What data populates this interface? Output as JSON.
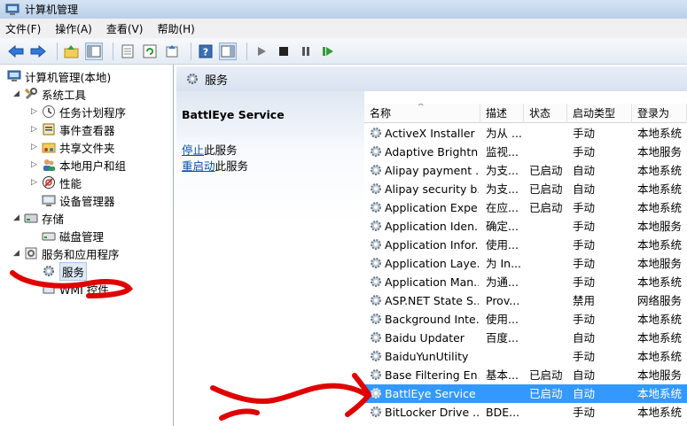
{
  "window": {
    "title": "计算机管理"
  },
  "menu": [
    "文件(F)",
    "操作(A)",
    "查看(V)",
    "帮助(H)"
  ],
  "toolbar": {
    "icons": [
      "back-icon",
      "forward-icon",
      "up-icon",
      "show-hide-tree-icon",
      "properties-icon",
      "refresh-icon",
      "export-icon",
      "help-icon",
      "show-hide-action-icon",
      "start-icon",
      "stop-icon",
      "pause-icon",
      "resume-icon"
    ]
  },
  "tree": [
    {
      "label": "计算机管理(本地)",
      "level": 0,
      "expander": "",
      "icon": "computer-icon"
    },
    {
      "label": "系统工具",
      "level": 1,
      "expander": "◢",
      "icon": "tools-icon"
    },
    {
      "label": "任务计划程序",
      "level": 2,
      "expander": "▷",
      "icon": "clock-icon"
    },
    {
      "label": "事件查看器",
      "level": 2,
      "expander": "▷",
      "icon": "event-viewer-icon"
    },
    {
      "label": "共享文件夹",
      "level": 2,
      "expander": "▷",
      "icon": "shared-folder-icon"
    },
    {
      "label": "本地用户和组",
      "level": 2,
      "expander": "▷",
      "icon": "users-icon"
    },
    {
      "label": "性能",
      "level": 2,
      "expander": "▷",
      "icon": "performance-icon"
    },
    {
      "label": "设备管理器",
      "level": 2,
      "expander": "",
      "icon": "device-manager-icon"
    },
    {
      "label": "存储",
      "level": 1,
      "expander": "◢",
      "icon": "storage-icon"
    },
    {
      "label": "磁盘管理",
      "level": 2,
      "expander": "",
      "icon": "disk-icon"
    },
    {
      "label": "服务和应用程序",
      "level": 1,
      "expander": "◢",
      "icon": "services-apps-icon"
    },
    {
      "label": "服务",
      "level": 2,
      "expander": "",
      "icon": "gear-icon",
      "selected": true
    },
    {
      "label": "WMI 控件",
      "level": 2,
      "expander": "",
      "icon": "wmi-icon"
    }
  ],
  "services_panel": {
    "title": "服务",
    "selected_service": "BattlEye Service",
    "actions": [
      {
        "link": "停止",
        "rest": "此服务"
      },
      {
        "link": "重启动",
        "rest": "此服务"
      }
    ]
  },
  "columns": [
    "名称",
    "描述",
    "状态",
    "启动类型",
    "登录为"
  ],
  "rows": [
    {
      "name": "ActiveX Installer ...",
      "desc": "为从 ...",
      "status": "",
      "startup": "手动",
      "logon": "本地系统"
    },
    {
      "name": "Adaptive Brightn...",
      "desc": "监视...",
      "status": "",
      "startup": "手动",
      "logon": "本地服务"
    },
    {
      "name": "Alipay payment ...",
      "desc": "为支...",
      "status": "已启动",
      "startup": "自动",
      "logon": "本地系统"
    },
    {
      "name": "Alipay security b...",
      "desc": "为支...",
      "status": "已启动",
      "startup": "自动",
      "logon": "本地系统"
    },
    {
      "name": "Application Expe...",
      "desc": "在应...",
      "status": "已启动",
      "startup": "手动",
      "logon": "本地系统"
    },
    {
      "name": "Application Iden...",
      "desc": "确定...",
      "status": "",
      "startup": "手动",
      "logon": "本地服务"
    },
    {
      "name": "Application Infor...",
      "desc": "使用...",
      "status": "",
      "startup": "手动",
      "logon": "本地系统"
    },
    {
      "name": "Application Laye...",
      "desc": "为 In...",
      "status": "",
      "startup": "手动",
      "logon": "本地服务"
    },
    {
      "name": "Application Man...",
      "desc": "为通...",
      "status": "",
      "startup": "手动",
      "logon": "本地系统"
    },
    {
      "name": "ASP.NET State S...",
      "desc": "Prov...",
      "status": "",
      "startup": "禁用",
      "logon": "网络服务"
    },
    {
      "name": "Background Inte...",
      "desc": "使用...",
      "status": "",
      "startup": "手动",
      "logon": "本地系统"
    },
    {
      "name": "Baidu Updater",
      "desc": "百度...",
      "status": "",
      "startup": "自动",
      "logon": "本地系统"
    },
    {
      "name": "BaiduYunUtility",
      "desc": "",
      "status": "",
      "startup": "手动",
      "logon": "本地系统"
    },
    {
      "name": "Base Filtering En...",
      "desc": "基本...",
      "status": "已启动",
      "startup": "自动",
      "logon": "本地服务"
    },
    {
      "name": "BattlEye Service",
      "desc": "",
      "status": "已启动",
      "startup": "自动",
      "logon": "本地系统",
      "selected": true
    },
    {
      "name": "BitLocker Drive ...",
      "desc": "BDE...",
      "status": "",
      "startup": "手动",
      "logon": "本地系统"
    }
  ],
  "colors": {
    "selection": "#3399ff",
    "link": "#0b4fa6",
    "annotation": "#e00000"
  }
}
